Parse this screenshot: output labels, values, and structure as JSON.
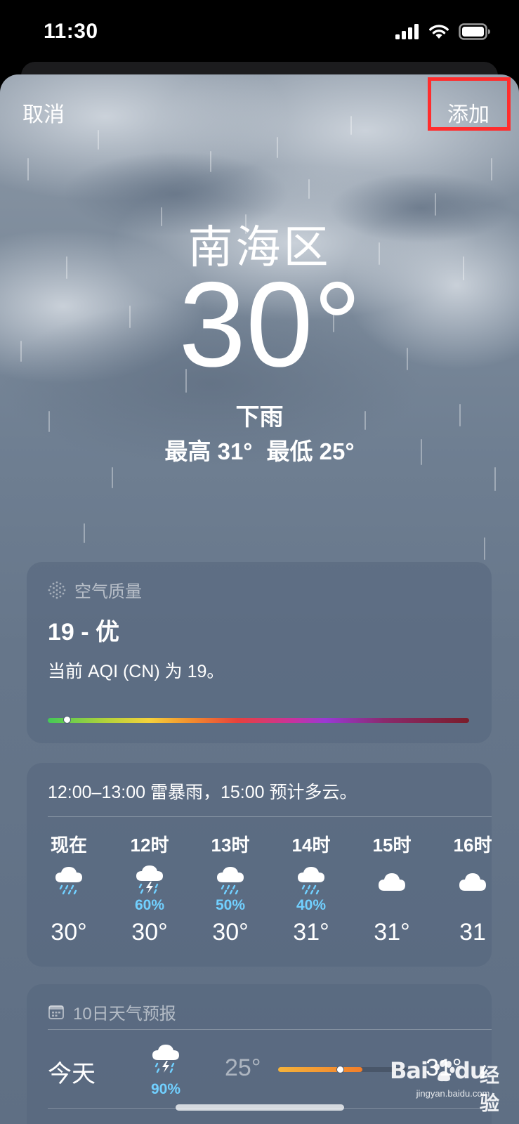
{
  "status_bar": {
    "time": "11:30"
  },
  "sheet": {
    "cancel_label": "取消",
    "add_label": "添加"
  },
  "current": {
    "city": "南海区",
    "temperature": "30°",
    "condition": "下雨",
    "high": "最高 31°",
    "low": "最低 25°"
  },
  "air_quality": {
    "header": "空气质量",
    "value_text": "19 - 优",
    "description": "当前 AQI (CN) 为 19。",
    "aqi": 19,
    "scale_position": 0.045
  },
  "hourly": {
    "summary": "12:00–13:00 雷暴雨，15:00 预计多云。",
    "items": [
      {
        "label": "现在",
        "icon": "cloud-rain-icon",
        "pop": "",
        "temp": "30°"
      },
      {
        "label": "12时",
        "icon": "cloud-bolt-rain-icon",
        "pop": "60%",
        "temp": "30°"
      },
      {
        "label": "13时",
        "icon": "cloud-rain-icon",
        "pop": "50%",
        "temp": "30°"
      },
      {
        "label": "14时",
        "icon": "cloud-rain-icon",
        "pop": "40%",
        "temp": "31°"
      },
      {
        "label": "15时",
        "icon": "cloud-icon",
        "pop": "",
        "temp": "31°"
      },
      {
        "label": "16时",
        "icon": "cloud-icon",
        "pop": "",
        "temp": "31"
      }
    ]
  },
  "forecast": {
    "header": "10日天气预报",
    "days": [
      {
        "name": "今天",
        "icon": "cloud-bolt-rain-icon",
        "pop": "90%",
        "low": "25°",
        "high": "31°",
        "range_start": 0.0,
        "range_end": 0.65,
        "current_pos": 0.48
      }
    ]
  },
  "watermark": {
    "main": "Bai",
    "suffix": "du",
    "cn": "经验",
    "url": "jingyan.baidu.com"
  },
  "colors": {
    "highlight": "#ff2d2d",
    "pop_blue": "#71d0ff"
  }
}
